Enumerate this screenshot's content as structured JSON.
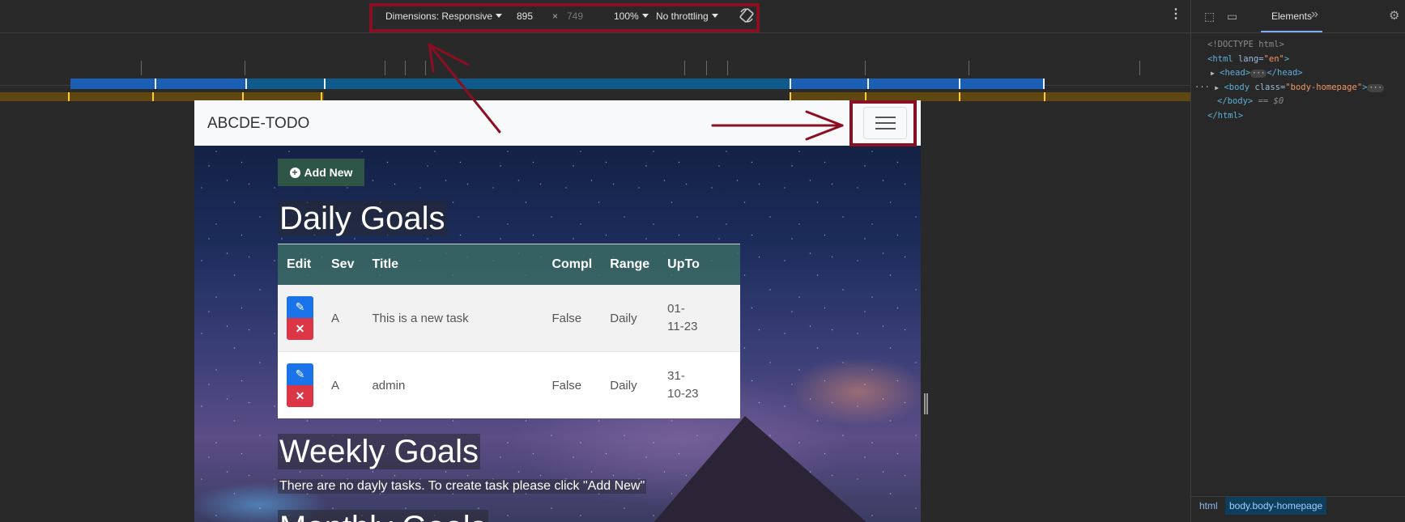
{
  "device_toolbar": {
    "dimensions_label": "Dimensions: Responsive",
    "width": "895",
    "times": "×",
    "height": "749",
    "zoom": "100%",
    "throttling": "No throttling"
  },
  "page": {
    "brand": "ABCDE-TODO",
    "add_new_label": "Add New",
    "daily": {
      "title": "Daily Goals",
      "columns": [
        "Edit",
        "Sev",
        "Title",
        "Compl",
        "Range",
        "UpTo"
      ],
      "rows": [
        {
          "sev": "A",
          "title": "This is a new task",
          "compl": "False",
          "range": "Daily",
          "upto_1": "01-",
          "upto_2": "11-23"
        },
        {
          "sev": "A",
          "title": "admin",
          "compl": "False",
          "range": "Daily",
          "upto_1": "31-",
          "upto_2": "10-23"
        }
      ]
    },
    "weekly": {
      "title": "Weekly Goals",
      "empty_message": "There are no dayly tasks. To create task please click \"Add New\""
    },
    "monthly": {
      "title": "Monthly Goals"
    }
  },
  "devtools": {
    "tab_elements": "Elements",
    "tree": {
      "doctype": "<!DOCTYPE html>",
      "html_open_tag": "<html",
      "html_attr_name": "lang=",
      "html_attr_value": "\"en\"",
      "html_open_close": ">",
      "head_open": "<head>",
      "head_close": "</head>",
      "body_open": "<body",
      "body_attr_name": "class=",
      "body_attr_value": "\"body-homepage\"",
      "body_open_close": ">",
      "body_close": "</body>",
      "selected_marker": "== $0",
      "html_close": "</html>"
    },
    "breadcrumb": {
      "html": "html",
      "body": "body.body-homepage"
    }
  },
  "colors": {
    "highlight": "#8b0f23",
    "add_new_bg": "#2f5548",
    "edit_button": "#1a73e8",
    "delete_button": "#dc3545"
  },
  "icons": [
    "caret-down-icon",
    "rotate-icon",
    "more-vertical-icon",
    "hamburger-icon",
    "plus-circle-icon",
    "pencil-icon",
    "times-icon",
    "inspect-icon",
    "device-toggle-icon",
    "chevrons-right-icon",
    "gear-icon"
  ]
}
